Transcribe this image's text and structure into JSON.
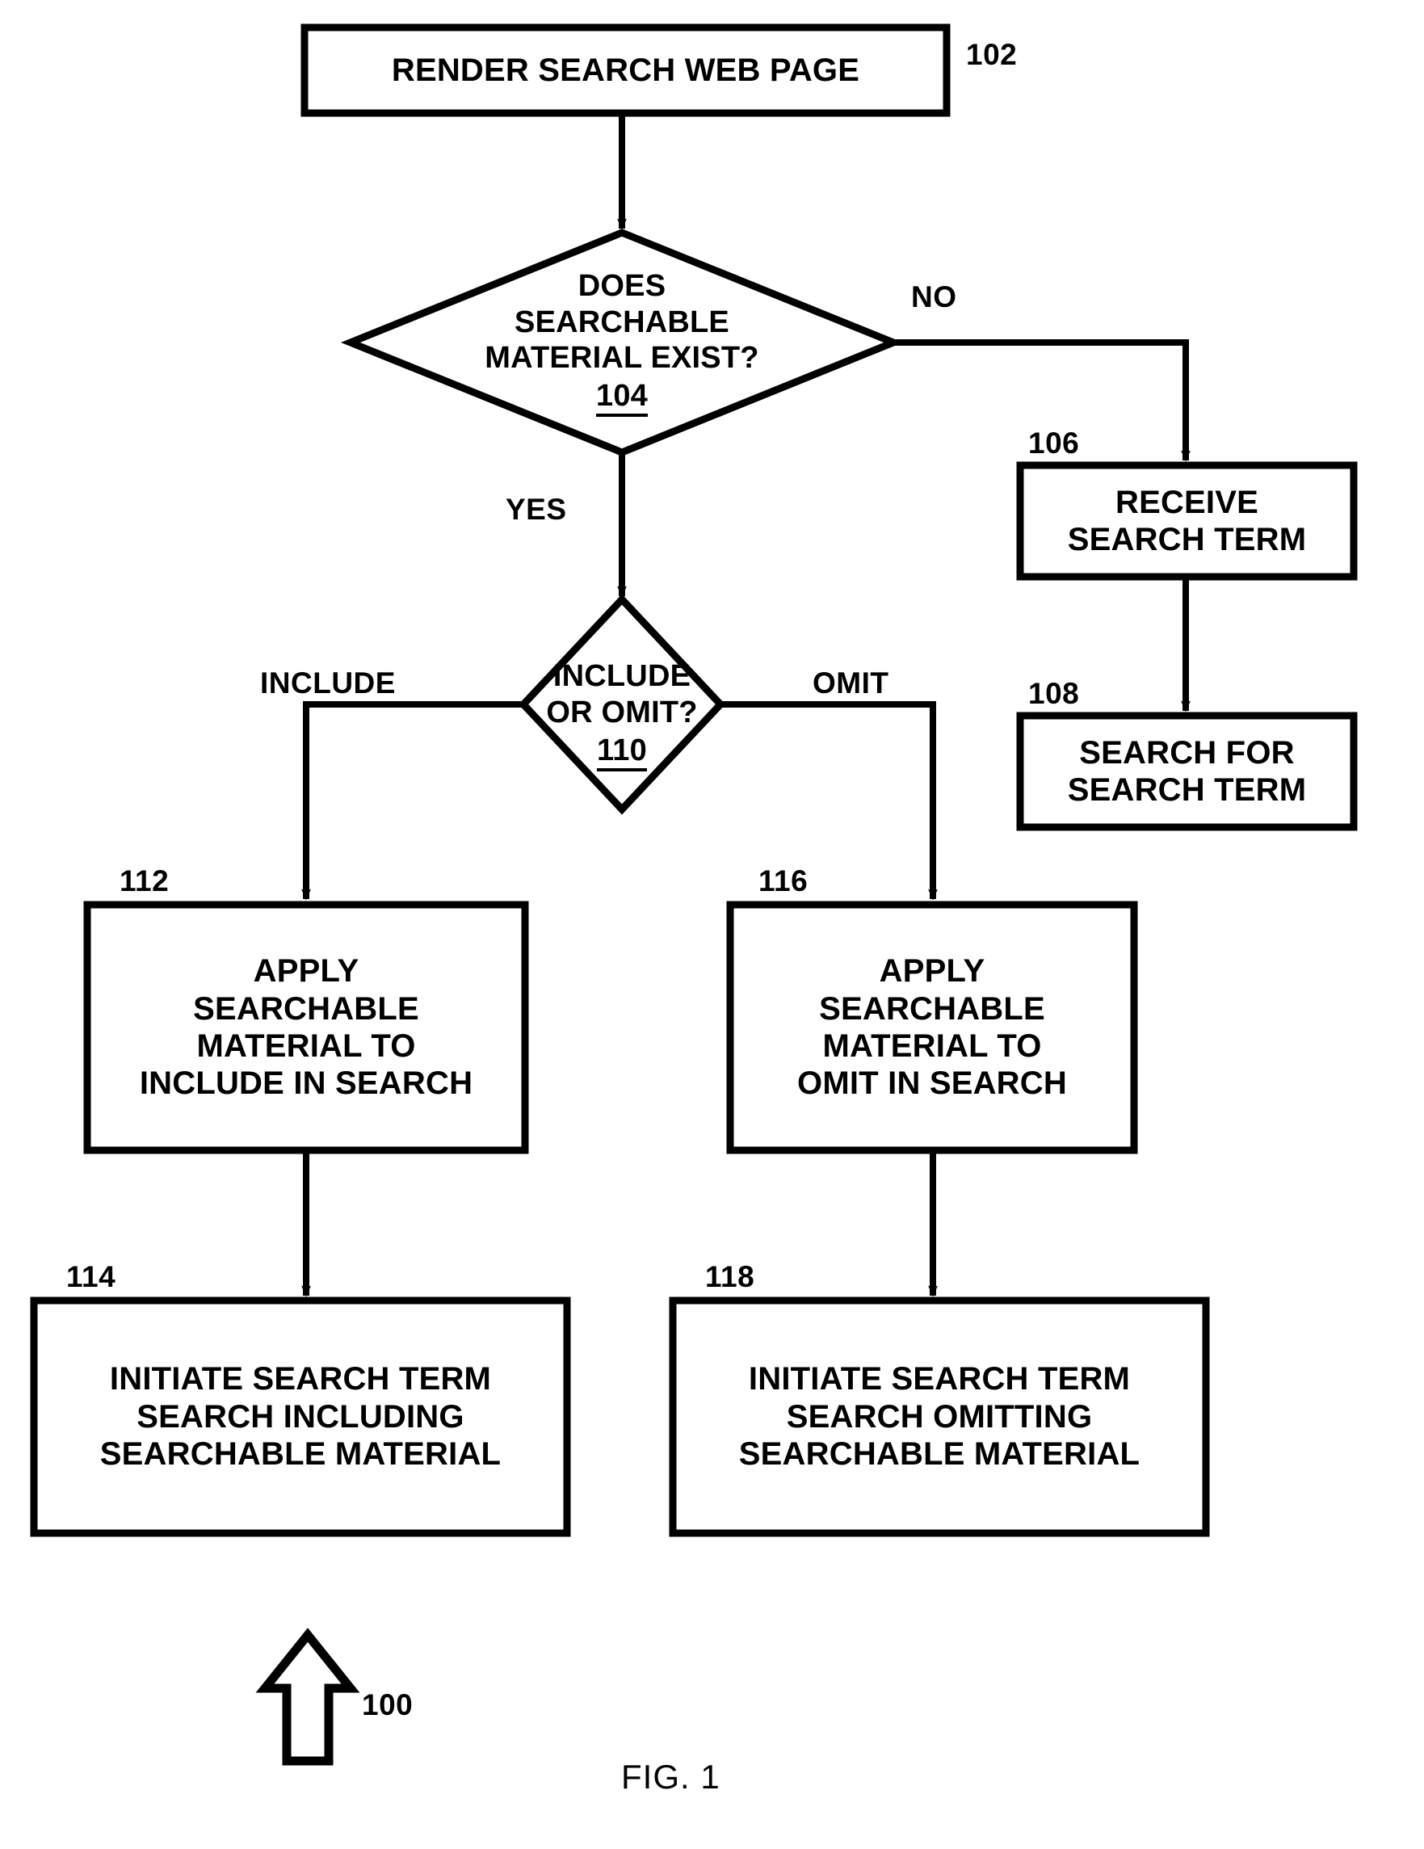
{
  "figure": {
    "caption": "FIG. 1",
    "overall_ref": "100"
  },
  "nodes": {
    "render_page": {
      "ref": "102",
      "shape": "rectangle",
      "lines": [
        "RENDER SEARCH WEB PAGE"
      ]
    },
    "searchable_exists": {
      "ref": "104",
      "shape": "diamond",
      "lines": [
        "DOES",
        "SEARCHABLE",
        "MATERIAL EXIST?"
      ]
    },
    "receive_term": {
      "ref": "106",
      "shape": "rectangle",
      "lines": [
        "RECEIVE",
        "SEARCH TERM"
      ]
    },
    "search_for_term": {
      "ref": "108",
      "shape": "rectangle",
      "lines": [
        "SEARCH FOR",
        "SEARCH TERM"
      ]
    },
    "include_or_omit": {
      "ref": "110",
      "shape": "diamond",
      "lines": [
        "INCLUDE",
        "OR OMIT?"
      ]
    },
    "apply_include": {
      "ref": "112",
      "shape": "rectangle",
      "lines": [
        "APPLY",
        "SEARCHABLE",
        "MATERIAL TO",
        "INCLUDE IN SEARCH"
      ]
    },
    "initiate_including": {
      "ref": "114",
      "shape": "rectangle",
      "lines": [
        "INITIATE SEARCH TERM",
        "SEARCH INCLUDING",
        "SEARCHABLE MATERIAL"
      ]
    },
    "apply_omit": {
      "ref": "116",
      "shape": "rectangle",
      "lines": [
        "APPLY",
        "SEARCHABLE",
        "MATERIAL TO",
        "OMIT IN SEARCH"
      ]
    },
    "initiate_omitting": {
      "ref": "118",
      "shape": "rectangle",
      "lines": [
        "INITIATE SEARCH TERM",
        "SEARCH OMITTING",
        "SEARCHABLE MATERIAL"
      ]
    }
  },
  "edge_labels": {
    "no": "NO",
    "yes": "YES",
    "include": "INCLUDE",
    "omit": "OMIT"
  },
  "colors": {
    "stroke": "#000000",
    "fill": "#ffffff",
    "background": "#ffffff"
  }
}
